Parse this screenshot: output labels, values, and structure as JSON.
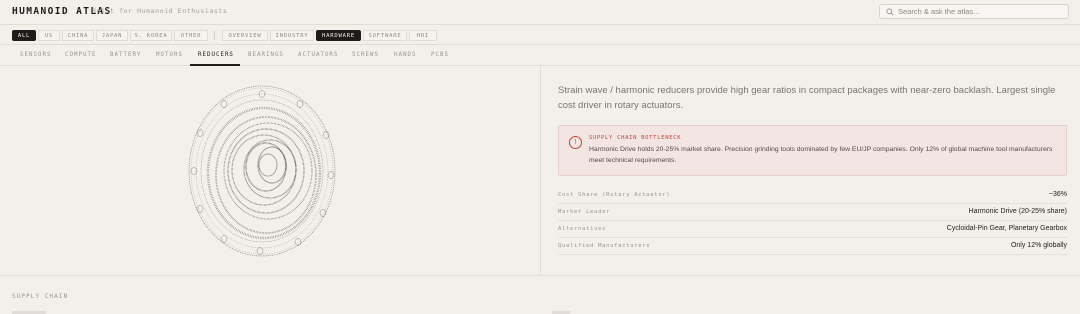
{
  "header": {
    "brand": "HUMANOID ATLAS",
    "tagline": "Built for Humanoid Enthusiasts",
    "search_placeholder": "Search & ask the atlas..."
  },
  "filters": {
    "regions": [
      "ALL",
      "US",
      "CHINA",
      "JAPAN",
      "S. KOREA",
      "OTHER"
    ],
    "views": [
      "OVERVIEW",
      "INDUSTRY",
      "HARDWARE",
      "SOFTWARE",
      "HRI"
    ],
    "active_region": "ALL",
    "active_view": "HARDWARE"
  },
  "categories": {
    "items": [
      "SENSORS",
      "COMPUTE",
      "BATTERY",
      "MOTORS",
      "REDUCERS",
      "BEARINGS",
      "ACTUATORS",
      "SCREWS",
      "HANDS",
      "PCBS"
    ],
    "active": "REDUCERS"
  },
  "detail": {
    "description": "Strain wave / harmonic reducers provide high gear ratios in compact packages with near-zero backlash. Largest single cost driver in rotary actuators.",
    "alert": {
      "icon": "!",
      "title": "SUPPLY CHAIN BOTTLENECK",
      "text": "Harmonic Drive holds 20-25% market share. Precision grinding tools dominated by few EU/JP companies. Only 12% of global machine tool manufacturers meet technical requirements."
    },
    "specs": [
      {
        "label": "Cost Share (Rotary Actuator)",
        "value": "~36%"
      },
      {
        "label": "Market Leader",
        "value": "Harmonic Drive (20-25% share)"
      },
      {
        "label": "Alternatives",
        "value": "Cycloidal-Pin Gear, Planetary Gearbox"
      },
      {
        "label": "Qualified Manufacturers",
        "value": "Only 12% globally"
      }
    ]
  },
  "sections": {
    "supply_chain": "SUPPLY CHAIN"
  },
  "colors": {
    "background": "#f3f0eb",
    "ink": "#1d1c1a",
    "alert_red": "#c2463d",
    "alert_bg": "#f3e5e2"
  }
}
